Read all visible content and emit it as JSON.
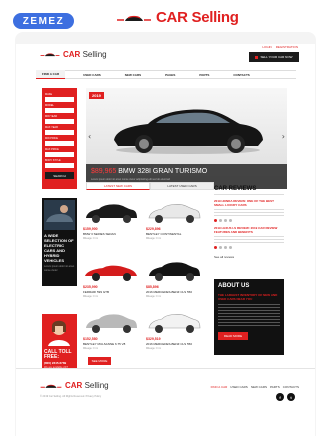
{
  "preview": {
    "badge": "ZEMEZ",
    "logo_word_a": "CAR",
    "logo_word_b": "Selling"
  },
  "site": {
    "logo_a": "CAR",
    "logo_b": "Selling",
    "header_links": [
      "LOGIN",
      "REGISTRATION"
    ],
    "sell_button": "SELL YOUR CAR NOW",
    "nav": [
      "FIND A CAR",
      "USED CARS",
      "NEW CARS",
      "PAGES",
      "PARTS",
      "CONTACTS"
    ]
  },
  "search": {
    "fields": [
      "MAKE",
      "MODEL",
      "MIN YEAR",
      "MAX YEAR",
      "MIN PRICE",
      "MAX PRICE",
      "BODY STYLE"
    ],
    "button": "SEARCH"
  },
  "hero": {
    "year": "2019",
    "price": "$89,965",
    "title": "BMW 328I GRAN TURISMO",
    "subtitle": "Lorem ipsum dolor sit amet conse ctetur adipisicing elit sed do eiusmod",
    "prev": "‹",
    "next": "›"
  },
  "tabs": [
    "LATEST NEW CARS",
    "LATEST USED CARS"
  ],
  "listings": [
    {
      "price": "$159,900",
      "name": "BMW 3 SERIES SEDAN",
      "meta": "Mileage: 0 mi"
    },
    {
      "price": "$229,896",
      "name": "BENTLEY CONTINENTAL",
      "meta": "Mileage: 0 mi"
    },
    {
      "price": "$235,990",
      "name": "FERRARI 599 GTB",
      "meta": "Mileage: 0 mi"
    },
    {
      "price": "$85,896",
      "name": "2016 MERCEDES-BENZ CLS 550",
      "meta": "Mileage: 0 mi"
    },
    {
      "price": "$152,580",
      "name": "BENTLEY MULSANNE 6.75 V8",
      "meta": "Mileage: 0 mi"
    },
    {
      "price": "$329,519",
      "name": "2016 MERCEDES-BENZ CLS 550",
      "meta": "Mileage: 0 mi"
    }
  ],
  "more_button": "SEE MORE",
  "promo1": {
    "title": "A WIDE SELECTION OF ELECTRIC CARS AND HYBRID VEHICLES",
    "text": "Lorem ipsum dolor sit amet conse ctetur"
  },
  "promo2": {
    "title": "CALL TOLL FREE:",
    "phone": "(800) 2345-6789",
    "text": "We are available 24/7"
  },
  "reviews": {
    "title": "CAR REVIEWS",
    "items": [
      "2019 HONDA REVIEW: ONE OF THE BEST SMALL LUXURY CARS",
      "2019 LEXUS LS REVIEW: 2019 CAR REVIEW FEATURES AND BENEFITS"
    ],
    "all": "See all reviews"
  },
  "about": {
    "title": "ABOUT US",
    "subtitle": "THE LARGEST INVENTORY OF NEW AND USED CARS NEAR YOU",
    "button": "READ MORE"
  },
  "footer": {
    "logo_a": "CAR",
    "logo_b": "Selling",
    "copyright": "© 2019 Car Selling. All Rights Reserved. Privacy Policy",
    "nav": [
      "FIND A CAR",
      "USED CARS",
      "NEW CARS",
      "PARTS",
      "CONTACTS"
    ],
    "social": [
      "f",
      "t"
    ]
  },
  "colors": {
    "accent": "#e02020",
    "dark": "#111111",
    "badge": "#3d6fe0"
  }
}
